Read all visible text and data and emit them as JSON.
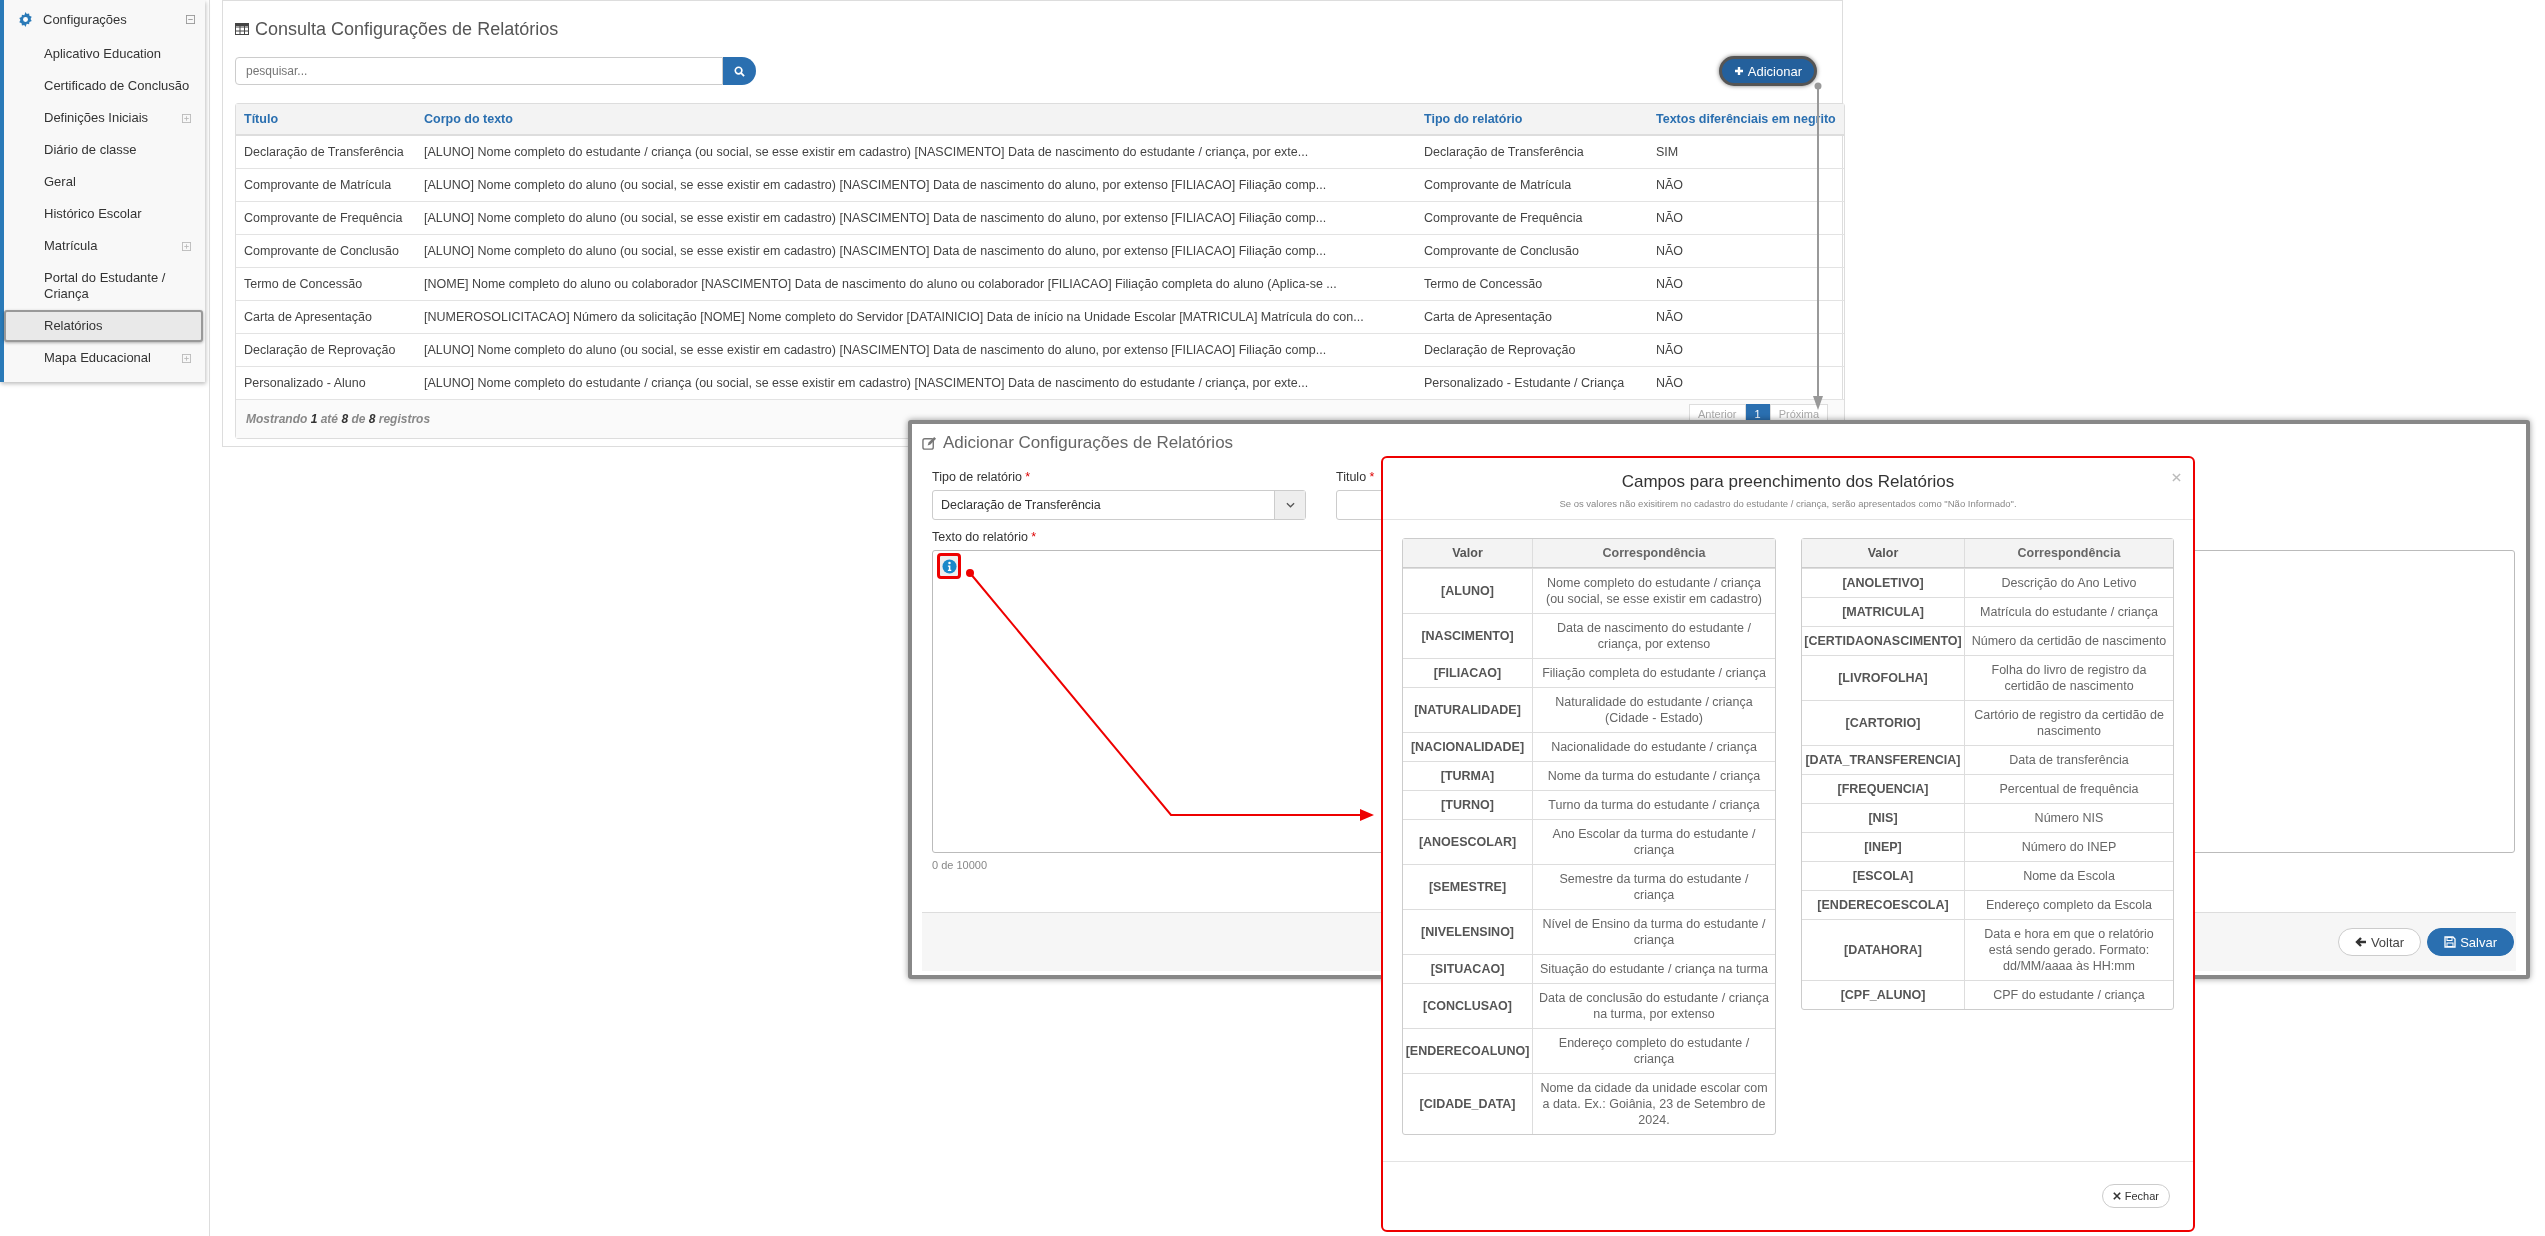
{
  "sidebar": {
    "header": {
      "label": "Configurações",
      "expanded": true
    },
    "items": [
      {
        "label": "Aplicativo Education",
        "expandable": false,
        "selected": false
      },
      {
        "label": "Certificado de Conclusão",
        "expandable": false,
        "selected": false
      },
      {
        "label": "Definições Iniciais",
        "expandable": true,
        "selected": false
      },
      {
        "label": "Diário de classe",
        "expandable": false,
        "selected": false
      },
      {
        "label": "Geral",
        "expandable": false,
        "selected": false
      },
      {
        "label": "Histórico Escolar",
        "expandable": false,
        "selected": false
      },
      {
        "label": "Matrícula",
        "expandable": true,
        "selected": false
      },
      {
        "label": "Portal do Estudante / Criança",
        "expandable": false,
        "selected": false
      },
      {
        "label": "Relatórios",
        "expandable": false,
        "selected": true
      },
      {
        "label": "Mapa Educacional",
        "expandable": true,
        "selected": false
      }
    ]
  },
  "main": {
    "title": "Consulta Configurações de Relatórios",
    "search": {
      "placeholder": "pesquisar..."
    },
    "add_button": "Adicionar",
    "table": {
      "columns": [
        "Título",
        "Corpo do texto",
        "Tipo do relatório",
        "Textos diferênciais em negrito"
      ],
      "rows": [
        [
          "Declaração de Transferência",
          "[ALUNO] Nome completo do estudante / criança (ou social, se esse existir em cadastro) [NASCIMENTO] Data de nascimento do estudante / criança, por exte...",
          "Declaração de Transferência",
          "SIM"
        ],
        [
          "Comprovante de Matrícula",
          "[ALUNO] Nome completo do aluno (ou social, se esse existir em cadastro) [NASCIMENTO] Data de nascimento do aluno, por extenso [FILIACAO] Filiação comp...",
          "Comprovante de Matrícula",
          "NÃO"
        ],
        [
          "Comprovante de Frequência",
          "[ALUNO] Nome completo do aluno (ou social, se esse existir em cadastro) [NASCIMENTO] Data de nascimento do aluno, por extenso [FILIACAO] Filiação comp...",
          "Comprovante de Frequência",
          "NÃO"
        ],
        [
          "Comprovante de Conclusão",
          "[ALUNO] Nome completo do aluno (ou social, se esse existir em cadastro) [NASCIMENTO] Data de nascimento do aluno, por extenso [FILIACAO] Filiação comp...",
          "Comprovante de Conclusão",
          "NÃO"
        ],
        [
          "Termo de Concessão",
          "[NOME] Nome completo do aluno ou colaborador [NASCIMENTO] Data de nascimento do aluno ou colaborador [FILIACAO] Filiação completa do aluno (Aplica-se ...",
          "Termo de Concessão",
          "NÃO"
        ],
        [
          "Carta de Apresentação",
          "[NUMEROSOLICITACAO] Número da solicitação [NOME] Nome completo do Servidor [DATAINICIO] Data de início na Unidade Escolar [MATRICULA] Matrícula do con...",
          "Carta de Apresentação",
          "NÃO"
        ],
        [
          "Declaração de Reprovação",
          "[ALUNO] Nome completo do aluno (ou social, se esse existir em cadastro) [NASCIMENTO] Data de nascimento do aluno, por extenso [FILIACAO] Filiação comp...",
          "Declaração de Reprovação",
          "NÃO"
        ],
        [
          "Personalizado - Aluno",
          "[ALUNO] Nome completo do estudante / criança (ou social, se esse existir em cadastro) [NASCIMENTO] Data de nascimento do estudante / criança, por exte...",
          "Personalizado - Estudante / Criança",
          "NÃO"
        ]
      ]
    },
    "footer_info": "Mostrando **1** até **8** de **8** registros",
    "pagination": [
      {
        "label": "Anterior",
        "selected": false
      },
      {
        "label": "1",
        "selected": true
      },
      {
        "label": "Próxima",
        "selected": false
      }
    ]
  },
  "add_dialog": {
    "title": "Adicionar Configurações de Relatórios",
    "type_field": {
      "label": "Tipo de relatório",
      "required_mark": "*",
      "value": "Declaração de Transferência"
    },
    "title_field": {
      "label": "Titulo",
      "required_mark": "*"
    },
    "text_field": {
      "label": "Texto do relatório",
      "required_mark": "*"
    },
    "counter": "0 de 10000",
    "buttons": [
      {
        "label": "Voltar",
        "kind": "back"
      },
      {
        "label": "Salvar",
        "kind": "save"
      }
    ]
  },
  "fields_popup": {
    "title": "Campos para preenchimento dos Relatórios",
    "subtitle": "Se os valores não exisitirem no cadastro do estudante / criança, serão apresentados como \"Não Informado\".",
    "tables": [
      {
        "columns": [
          "Valor",
          "Correspondência"
        ],
        "rows": [
          [
            "[ALUNO]",
            "Nome completo do estudante / criança (ou social, se esse existir em cadastro)"
          ],
          [
            "[NASCIMENTO]",
            "Data de nascimento do estudante / criança, por extenso"
          ],
          [
            "[FILIACAO]",
            "Filiação completa do estudante / criança"
          ],
          [
            "[NATURALIDADE]",
            "Naturalidade do estudante / criança (Cidade - Estado)"
          ],
          [
            "[NACIONALIDADE]",
            "Nacionalidade do estudante / criança"
          ],
          [
            "[TURMA]",
            "Nome da turma do estudante / criança"
          ],
          [
            "[TURNO]",
            "Turno da turma do estudante / criança"
          ],
          [
            "[ANOESCOLAR]",
            "Ano Escolar da turma do estudante / criança"
          ],
          [
            "[SEMESTRE]",
            "Semestre da turma do estudante / criança"
          ],
          [
            "[NIVELENSINO]",
            "Nível de Ensino da turma do estudante / criança"
          ],
          [
            "[SITUACAO]",
            "Situação do estudante / criança na turma"
          ],
          [
            "[CONCLUSAO]",
            "Data de conclusão do estudante / criança na turma, por extenso"
          ],
          [
            "[ENDERECOALUNO]",
            "Endereço completo do estudante / criança"
          ],
          [
            "[CIDADE_DATA]",
            "Nome da cidade da unidade escolar com a data. Ex.: Goiânia, 23 de Setembro de 2024."
          ]
        ]
      },
      {
        "columns": [
          "Valor",
          "Correspondência"
        ],
        "rows": [
          [
            "[ANOLETIVO]",
            "Descrição do Ano Letivo"
          ],
          [
            "[MATRICULA]",
            "Matrícula do estudante / criança"
          ],
          [
            "[CERTIDAONASCIMENTO]",
            "Número da certidão de nascimento"
          ],
          [
            "[LIVROFOLHA]",
            "Folha do livro de registro da certidão de nascimento"
          ],
          [
            "[CARTORIO]",
            "Cartório de registro da certidão de nascimento"
          ],
          [
            "[DATA_TRANSFERENCIA]",
            "Data de transferência"
          ],
          [
            "[FREQUENCIA]",
            "Percentual de frequência"
          ],
          [
            "[NIS]",
            "Número NIS"
          ],
          [
            "[INEP]",
            "Número do INEP"
          ],
          [
            "[ESCOLA]",
            "Nome da Escola"
          ],
          [
            "[ENDERECOESCOLA]",
            "Endereço completo da Escola"
          ],
          [
            "[DATAHORA]",
            "Data e hora em que o relatório está sendo gerado. Formato: dd/MM/aaaa às HH:mm"
          ],
          [
            "[CPF_ALUNO]",
            "CPF do estudante / criança"
          ]
        ]
      }
    ],
    "close_button": "Fechar"
  }
}
